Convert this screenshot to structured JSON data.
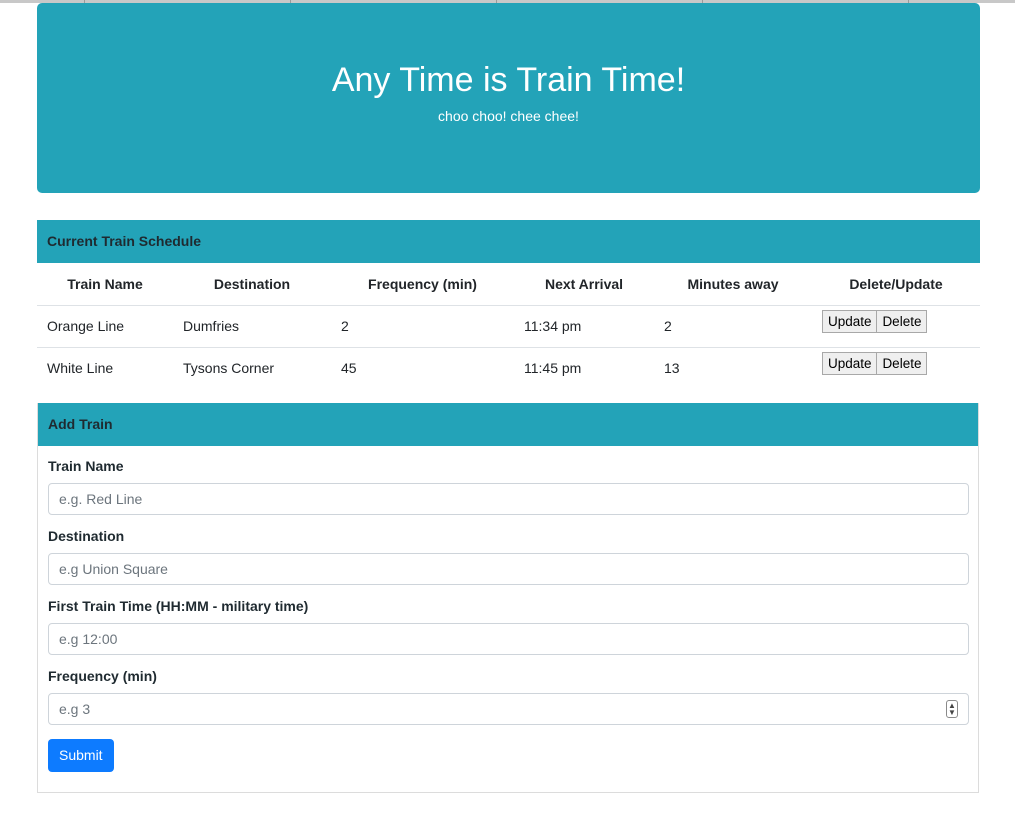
{
  "header": {
    "title": "Any Time is Train Time!",
    "subtitle": "choo choo! chee chee!"
  },
  "schedule": {
    "heading": "Current Train Schedule",
    "columns": [
      "Train Name",
      "Destination",
      "Frequency (min)",
      "Next Arrival",
      "Minutes away",
      "Delete/Update"
    ],
    "rows": [
      {
        "name": "Orange Line",
        "destination": "Dumfries",
        "frequency": "2",
        "next_arrival": "11:34 pm",
        "minutes_away": "2"
      },
      {
        "name": "White Line",
        "destination": "Tysons Corner",
        "frequency": "45",
        "next_arrival": "11:45 pm",
        "minutes_away": "13"
      }
    ],
    "update_label": "Update",
    "delete_label": "Delete"
  },
  "form": {
    "heading": "Add Train",
    "fields": [
      {
        "label": "Train Name",
        "placeholder": "e.g. Red Line"
      },
      {
        "label": "Destination",
        "placeholder": "e.g Union Square"
      },
      {
        "label": "First Train Time (HH:MM - military time)",
        "placeholder": "e.g 12:00"
      },
      {
        "label": "Frequency (min)",
        "placeholder": "e.g 3"
      }
    ],
    "submit_label": "Submit"
  },
  "colors": {
    "accent": "#23a3b8",
    "primary_button": "#0d7bff"
  }
}
